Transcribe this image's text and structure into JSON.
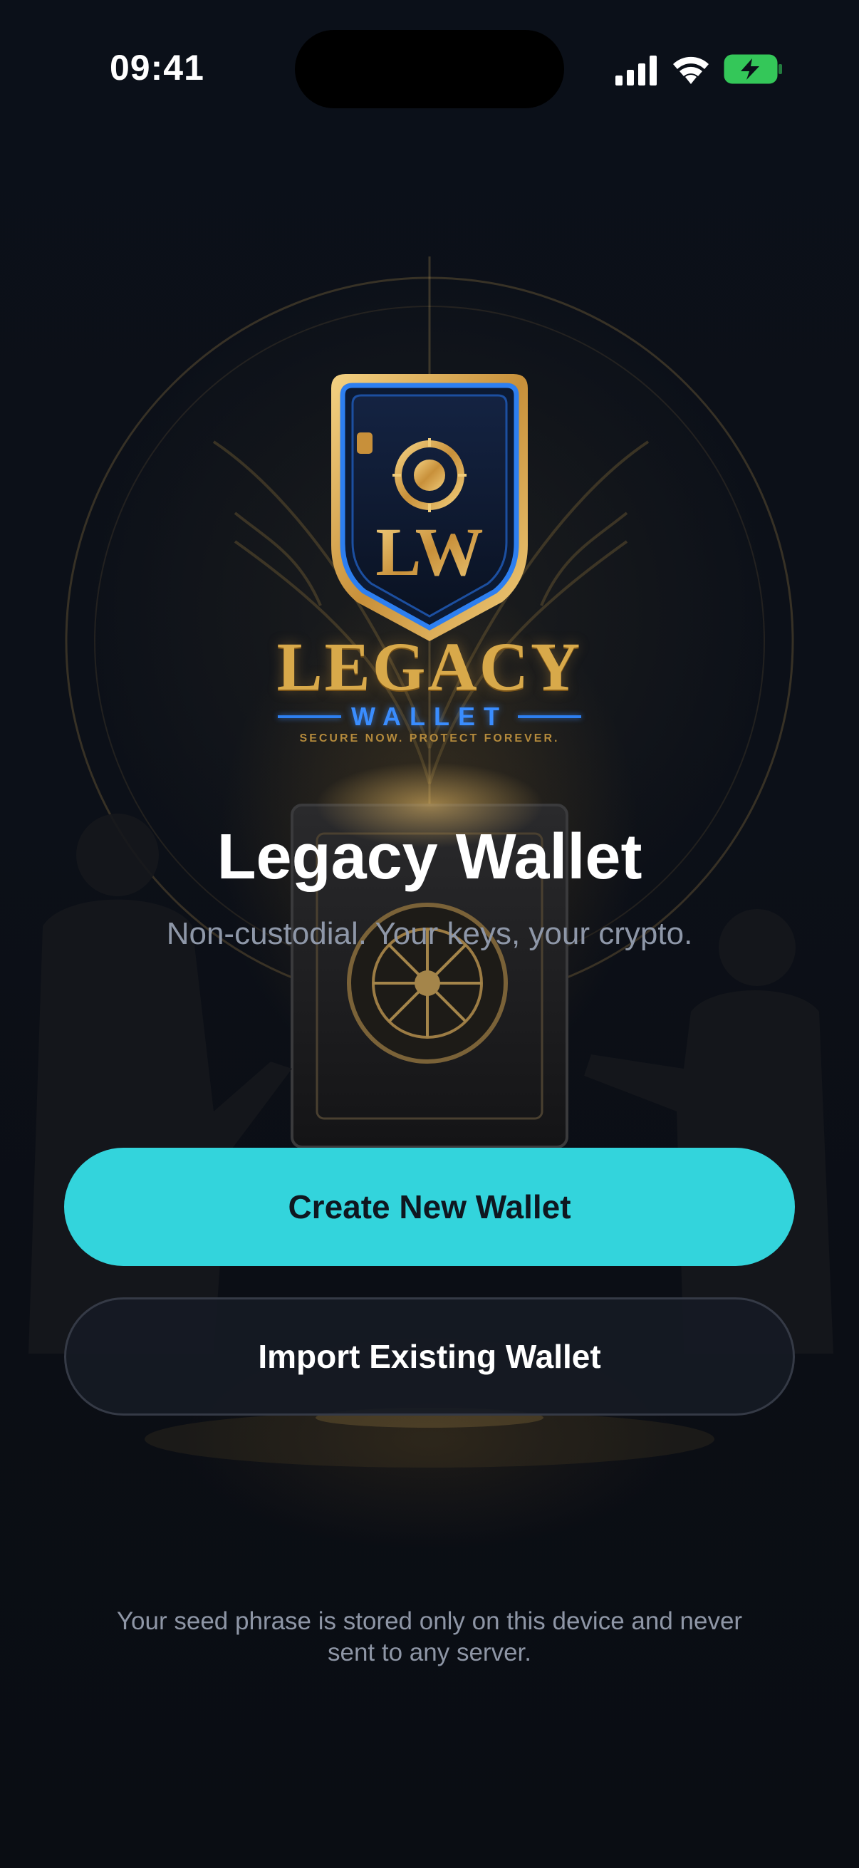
{
  "status_bar": {
    "time": "09:41",
    "icons": [
      "cellular-signal-icon",
      "wifi-icon",
      "battery-charging-icon"
    ],
    "battery_color": "#34c759"
  },
  "logo": {
    "monogram": "LW",
    "wordmark": "LEGACY",
    "submark": "WALLET",
    "tagline": "SECURE NOW. PROTECT FOREVER."
  },
  "hero": {
    "title": "Legacy Wallet",
    "subtitle": "Non-custodial. Your keys, your crypto."
  },
  "actions": {
    "create_label": "Create New Wallet",
    "import_label": "Import Existing Wallet"
  },
  "footer": {
    "note": "Your seed phrase is stored only on this device and never sent to any server."
  },
  "colors": {
    "primary_button": "#33d4dc",
    "secondary_button": "#161a24",
    "gold": "#d8a94a",
    "logo_blue": "#2d7ff0",
    "background": "#0b0f16"
  }
}
